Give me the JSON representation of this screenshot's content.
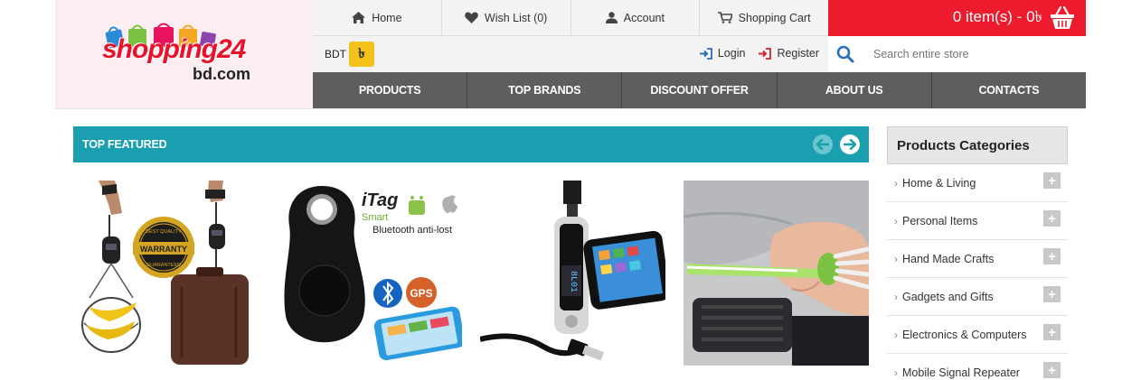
{
  "logo": {
    "main": "shopping24",
    "sub": "bd.com"
  },
  "top_links": [
    {
      "label": "Home",
      "icon": "home-icon"
    },
    {
      "label": "Wish List (0)",
      "icon": "heart-icon"
    },
    {
      "label": "Account",
      "icon": "user-icon"
    },
    {
      "label": "Shopping Cart",
      "icon": "cart-icon"
    }
  ],
  "cart": {
    "summary": "0 item(s) - 0৳",
    "icon": "basket-icon"
  },
  "currency": {
    "label": "BDT",
    "symbol": "৳"
  },
  "auth": {
    "login": "Login",
    "register": "Register"
  },
  "search": {
    "placeholder": "Search entire store"
  },
  "nav": [
    "PRODUCTS",
    "TOP BRANDS",
    "DISCOUNT OFFER",
    "ABOUT US",
    "CONTACTS"
  ],
  "featured": {
    "title": "TOP FEATURED"
  },
  "products": [
    {
      "image": "luggage-scale-image",
      "badge": "1 YEAR PARTS & LABOR WARRANTY",
      "badge_top": "BEST QUALITY",
      "badge_bottom": "GUARANTEED"
    },
    {
      "image": "itag-tracker-image",
      "title": "iTag",
      "subtitle": "Smart",
      "desc": "Bluetooth anti-lost",
      "gps": "GPS"
    },
    {
      "image": "fm-transmitter-image",
      "display": "8L01"
    },
    {
      "image": "vent-brush-image"
    }
  ],
  "categories": {
    "title": "Products Categories",
    "items": [
      "Home & Living",
      "Personal Items",
      "Hand Made Crafts",
      "Gadgets and Gifts",
      "Electronics & Computers",
      "Mobile Signal Repeater"
    ]
  },
  "colors": {
    "red": "#ed1b2e",
    "teal": "#1a9fb1",
    "nav": "#5e5e5e",
    "yellow": "#f3c21b"
  }
}
